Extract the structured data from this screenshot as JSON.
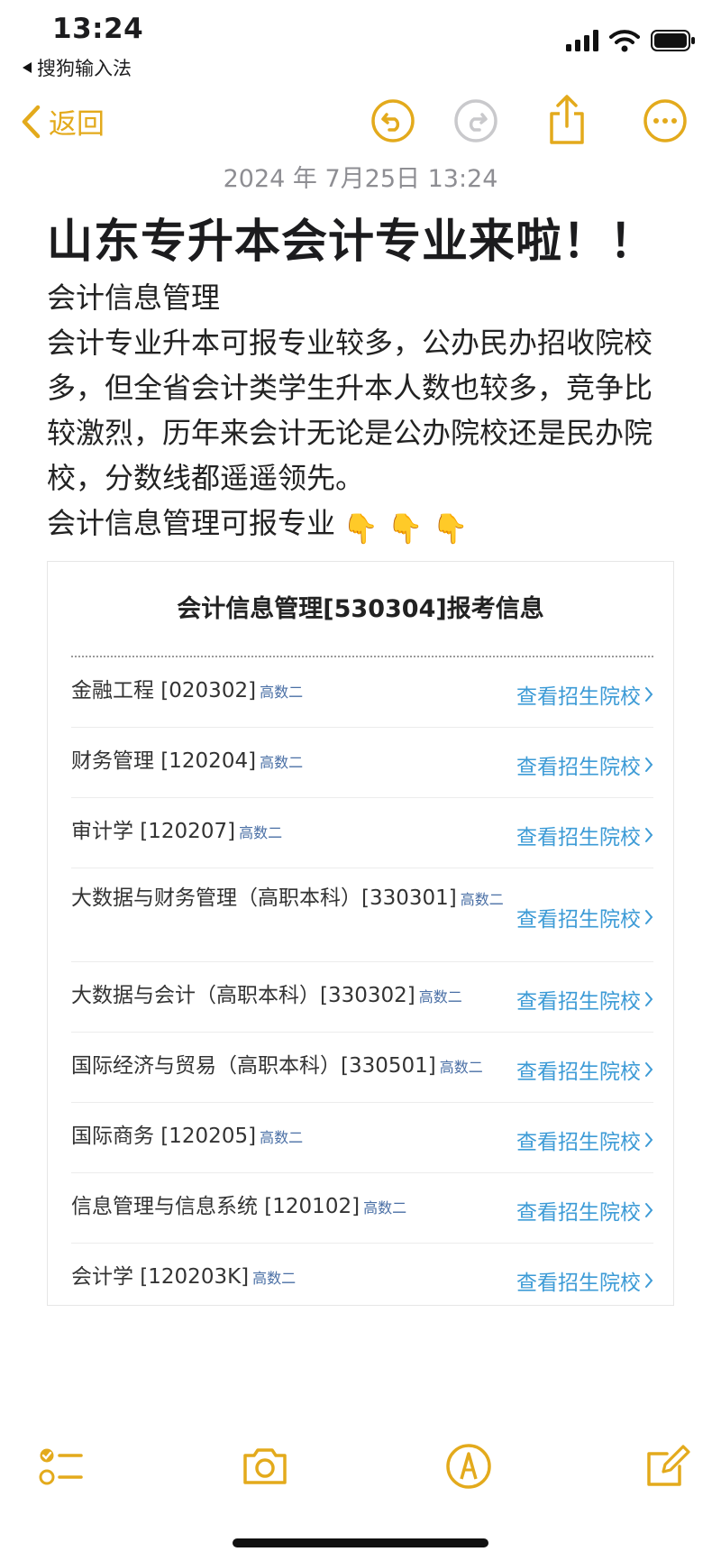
{
  "status_bar": {
    "time": "13:24",
    "back_app": "搜狗输入法"
  },
  "nav": {
    "back_label": "返回"
  },
  "note": {
    "date": "2024 年 7月25日 13:24",
    "title": "山东专升本会计专业来啦！！",
    "paragraphs": [
      "会计信息管理",
      "会计专业升本可报专业较多，公办民办招收院校多，但全省会计类学生升本人数也较多，竞争比较激烈，历年来会计无论是公办院校还是民办院校，分数线都遥遥领先。",
      "会计信息管理可报专业"
    ],
    "emoji": "👇"
  },
  "table": {
    "title": "会计信息管理[530304]报考信息",
    "link_label": "查看招生院校",
    "rows": [
      {
        "major": "金融工程 [020302]",
        "tag": "高数二"
      },
      {
        "major": "财务管理 [120204]",
        "tag": "高数二"
      },
      {
        "major": "审计学 [120207]",
        "tag": "高数二"
      },
      {
        "major": "大数据与财务管理（高职本科）[330301]",
        "tag": "高数二"
      },
      {
        "major": "大数据与会计（高职本科）[330302]",
        "tag": "高数二"
      },
      {
        "major": "国际经济与贸易（高职本科）[330501]",
        "tag": "高数二"
      },
      {
        "major": "国际商务 [120205]",
        "tag": "高数二"
      },
      {
        "major": "信息管理与信息系统 [120102]",
        "tag": "高数二"
      },
      {
        "major": "会计学 [120203K]",
        "tag": "高数二"
      }
    ]
  },
  "colors": {
    "accent": "#e3aa1c",
    "link": "#3d9bd6"
  },
  "icons": [
    "undo-icon",
    "redo-icon",
    "share-icon",
    "more-icon",
    "checklist-icon",
    "camera-icon",
    "markup-icon",
    "compose-icon"
  ]
}
